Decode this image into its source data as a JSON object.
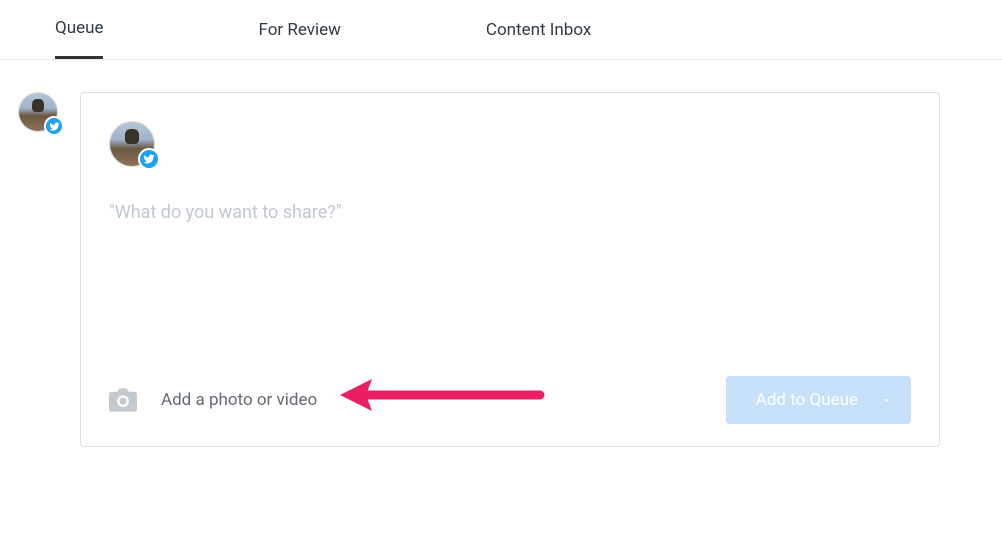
{
  "tabs": [
    {
      "label": "Queue",
      "active": true
    },
    {
      "label": "For Review",
      "active": false
    },
    {
      "label": "Content Inbox",
      "active": false
    }
  ],
  "composer": {
    "placeholder": "\"What do you want to share?\"",
    "add_media_label": "Add a photo or video",
    "submit_label": "Add to Queue"
  }
}
